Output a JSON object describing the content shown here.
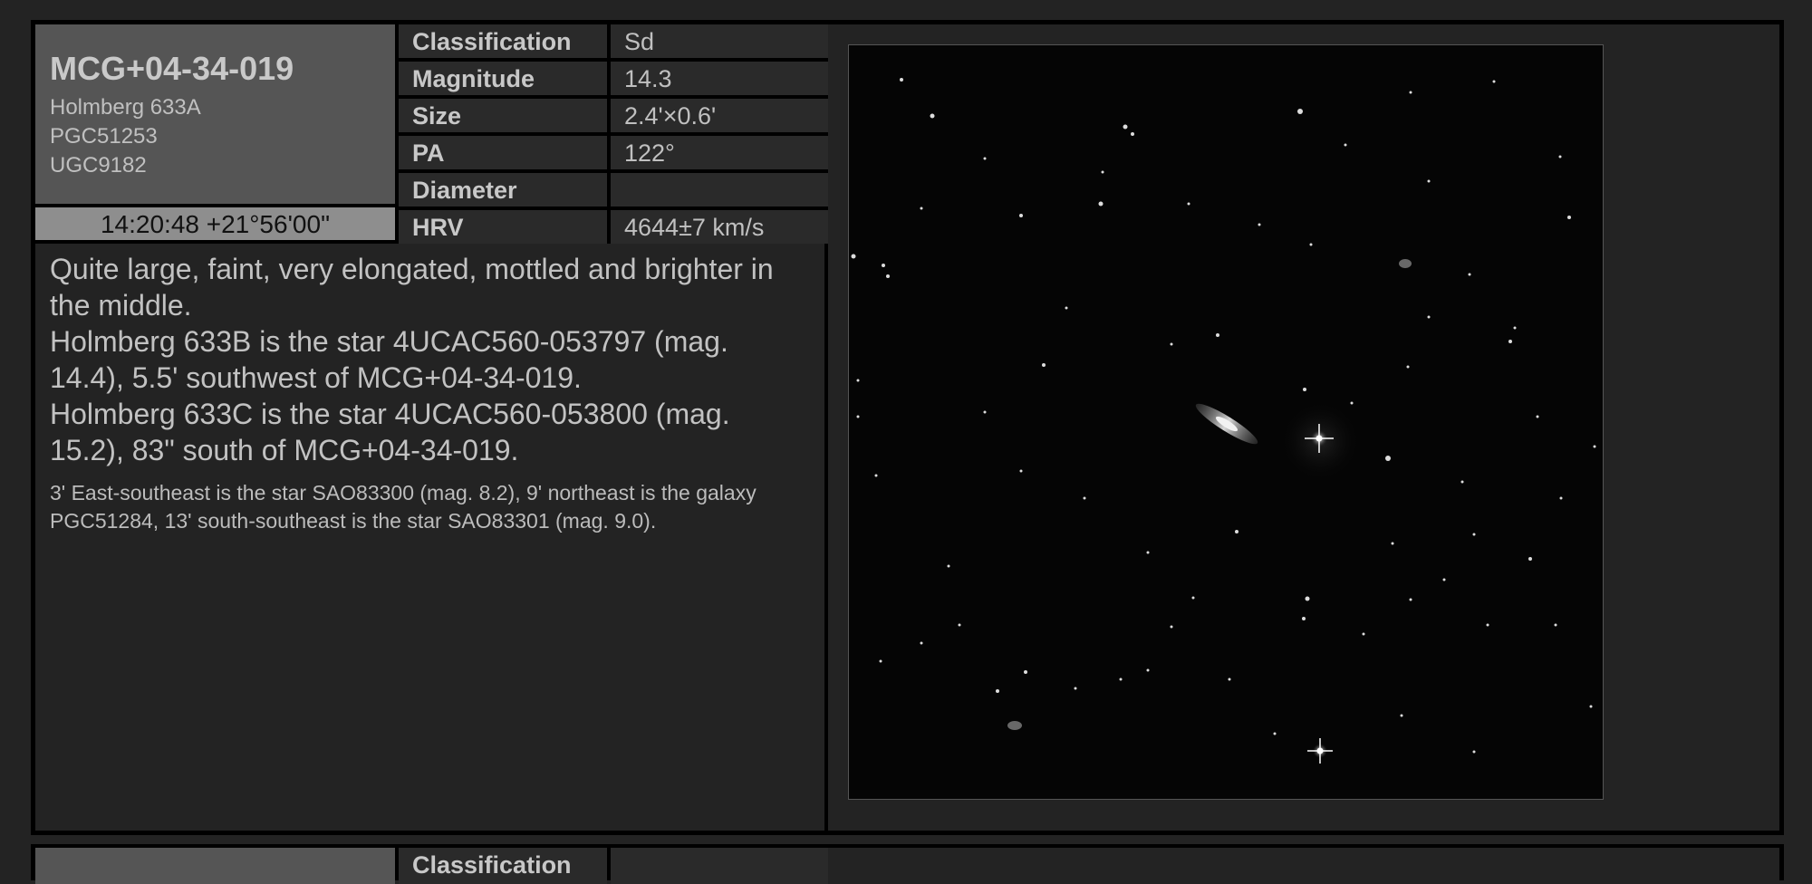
{
  "object": {
    "name": "MCG+04-34-019",
    "aliases": [
      "Holmberg 633A",
      "PGC51253",
      "UGC9182"
    ],
    "coordinates": "14:20:48 +21°56'00\""
  },
  "properties": [
    {
      "label": "Classification",
      "value": "Sd"
    },
    {
      "label": "Magnitude",
      "value": "14.3"
    },
    {
      "label": "Size",
      "value": "2.4'×0.6'"
    },
    {
      "label": "PA",
      "value": "122°"
    },
    {
      "label": "Diameter",
      "value": ""
    },
    {
      "label": "HRV",
      "value": "4644±7 km/s"
    }
  ],
  "description": {
    "paragraphs": [
      "Quite large, faint, very elongated, mottled and brighter in the middle.",
      "Holmberg 633B is the star 4UCAC560-053797 (mag. 14.4), 5.5' southwest of MCG+04-34-019.",
      "Holmberg 633C is the star 4UCAC560-053800 (mag. 15.2), 83\" south of MCG+04-34-019."
    ],
    "note": "3' East-southeast is the star SAO83300 (mag. 8.2), 9' northeast is the galaxy PGC51284, 13' south-southeast is the star SAO83301 (mag. 9.0)."
  },
  "next_card": {
    "first_label": "Classification"
  }
}
